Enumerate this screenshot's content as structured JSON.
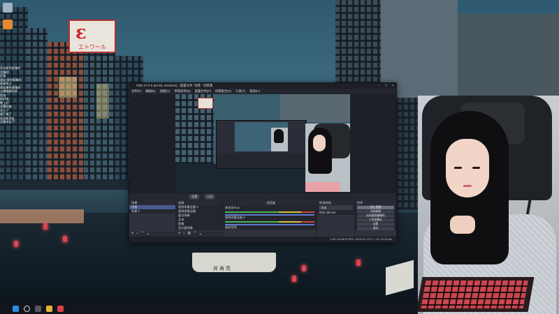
{
  "obs": {
    "title": "OBS 27.0.0 (64-bit, windows) - 配置文件: 场景 - 场景集",
    "menu": [
      "文件(F)",
      "编辑(E)",
      "视图(V)",
      "停靠部件(D)",
      "配置文件(P)",
      "场景集合(S)",
      "工具(T)",
      "帮助(H)"
    ],
    "preview_buttons": [
      "设置",
      "过滤"
    ],
    "docks": {
      "scenes": {
        "title": "场景",
        "items": [
          "场景",
          "场景 2"
        ]
      },
      "sources": {
        "title": "来源",
        "items": [
          "视频采集设备 2",
          "视频采集设备",
          "窗口采集",
          "文本",
          "图像",
          "显示器采集"
        ]
      },
      "mixer": {
        "title": "混音器",
        "channels": [
          "麦克风/Aux",
          "视频采集设备 2",
          "桌面音频"
        ]
      },
      "transitions": {
        "title": "转场特效",
        "type": "淡出",
        "duration_label": "时长",
        "duration": "300 ms"
      },
      "controls": {
        "title": "控件",
        "buttons": [
          "停止直播",
          "开始录制",
          "启动虚拟摄像机",
          "工作室模式",
          "设置",
          "退出"
        ]
      }
    },
    "status": "LIVE: 00:48:02   REC: 00:00:00   CPU: 7.4%, 60.00 fps"
  },
  "desktop": {
    "sign_glyph": "ε",
    "sign_text": "エトワール",
    "chat_lines": [
      "欢迎来到直播间",
      "主播好",
      "好看",
      "欢迎 来到直播间",
      "感谢关注",
      "欢迎来到直播间",
      "主播唱歌好听",
      "加油",
      "好好听",
      "晚上好",
      "主播好美",
      "关注了",
      "来了来了",
      "欢迎新朋友",
      "主播辛苦了"
    ],
    "boat_text": "丼 再 亮"
  },
  "colors": {
    "obs_bg": "#2b2e38",
    "accent_selection": "#4a5a8a",
    "lantern": "#e0434f"
  }
}
